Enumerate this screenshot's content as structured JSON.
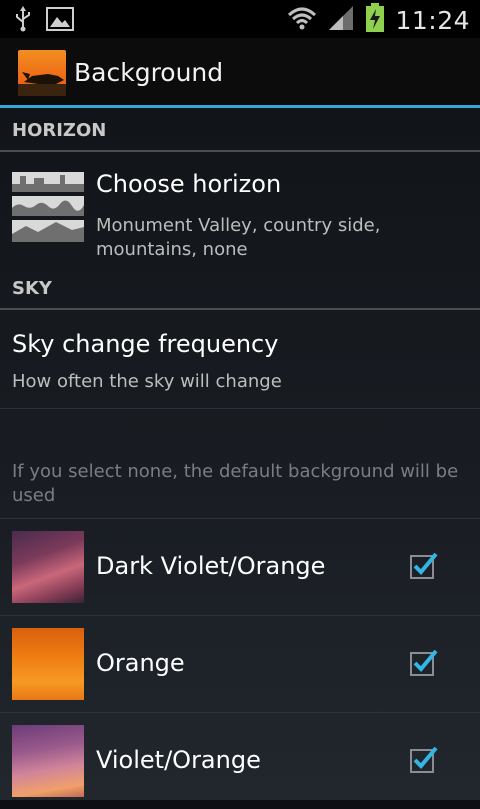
{
  "status_bar": {
    "time": "11:24",
    "icons": [
      "usb-icon",
      "image-icon",
      "wifi-icon",
      "signal-icon",
      "battery-charging-icon"
    ]
  },
  "action_bar": {
    "title": "Background",
    "icon": "app-icon"
  },
  "sections": {
    "horizon": {
      "header": "HORIZON",
      "choose_horizon": {
        "title": "Choose horizon",
        "summary": "Monument Valley, country side, mountains, none"
      }
    },
    "sky": {
      "header": "SKY",
      "frequency": {
        "title": "Sky change frequency",
        "summary": "How often the sky will change"
      },
      "hint": "If you select none, the default background will be used",
      "options": [
        {
          "label": "Dark Violet/Orange",
          "checked": true
        },
        {
          "label": "Orange",
          "checked": true
        },
        {
          "label": "Violet/Orange",
          "checked": true
        }
      ]
    }
  },
  "colors": {
    "accent": "#34a8d6",
    "check": "#33b5e5"
  }
}
